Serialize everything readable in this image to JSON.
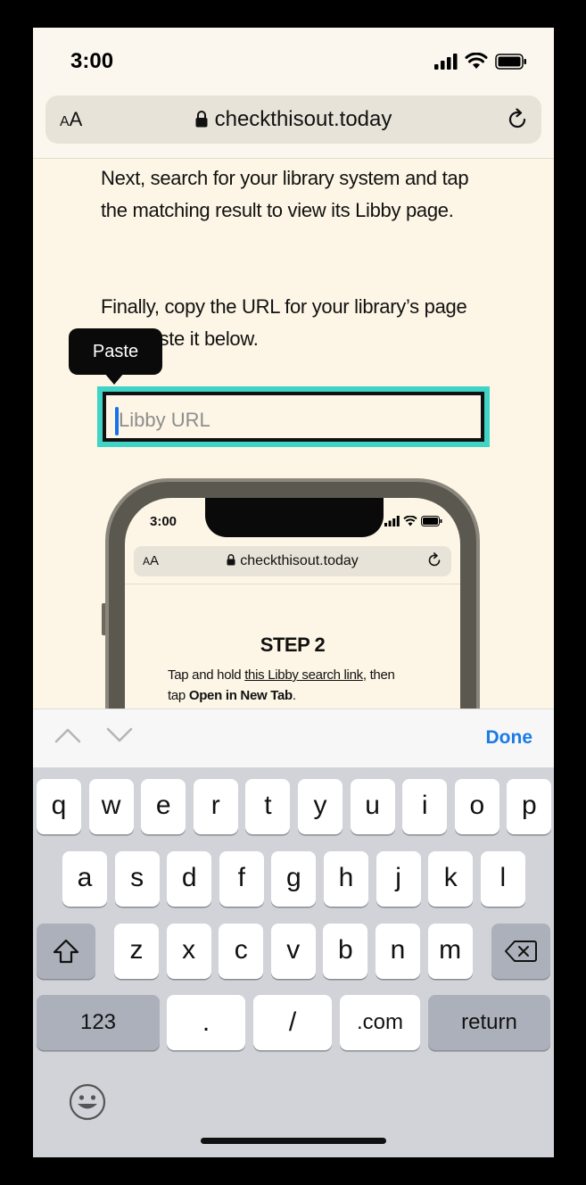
{
  "status_bar": {
    "time": "3:00"
  },
  "address_bar": {
    "aa_big": "A",
    "aa_small": "A",
    "url": "checkthisout.today"
  },
  "page": {
    "paragraph1": "Next, search for your library system and tap the matching result to view its Libby page.",
    "paragraph2": "Finally, copy the URL for your library’s page and paste it below.",
    "paste_popup": "Paste",
    "url_placeholder": "Libby URL"
  },
  "illustration": {
    "time": "3:00",
    "url": "checkthisout.today",
    "aa_small": "A",
    "aa_big": "A",
    "step_title": "STEP 2",
    "line1_pre": "Tap and hold ",
    "line1_link": "this Libby search link",
    "line1_post": ", then",
    "line2_pre": "tap ",
    "line2_bold": "Open in New Tab",
    "line2_post": "."
  },
  "accessory": {
    "done_label": "Done"
  },
  "keyboard": {
    "row1": [
      "q",
      "w",
      "e",
      "r",
      "t",
      "y",
      "u",
      "i",
      "o",
      "p"
    ],
    "row2": [
      "a",
      "s",
      "d",
      "f",
      "g",
      "h",
      "j",
      "k",
      "l"
    ],
    "row3": [
      "z",
      "x",
      "c",
      "v",
      "b",
      "n",
      "m"
    ],
    "numbers_label": "123",
    "dot_label": ".",
    "slash_label": "/",
    "dotcom_label": ".com",
    "return_label": "return"
  },
  "colors": {
    "accent_teal": "#3fd4c5",
    "link_blue": "#1a7ae6",
    "page_bg": "#fdf6e6"
  }
}
